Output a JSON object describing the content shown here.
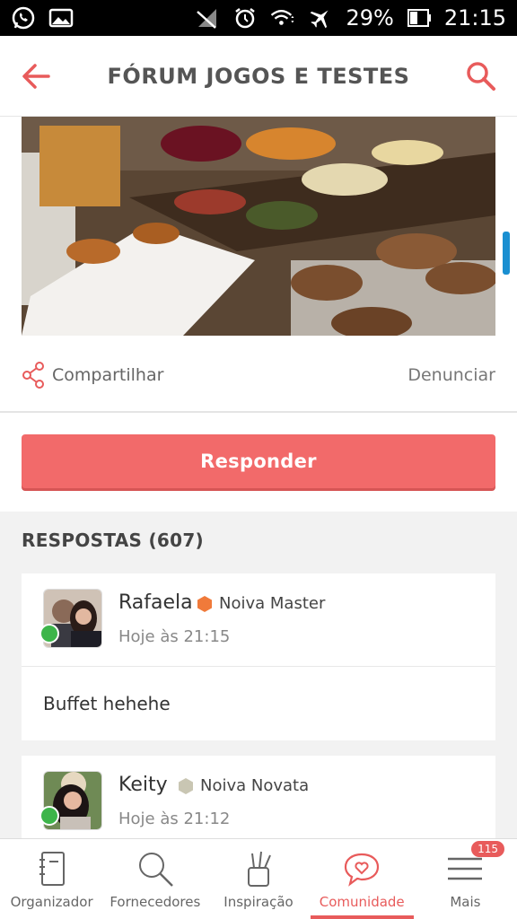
{
  "status_bar": {
    "battery": "29%",
    "time": "21:15"
  },
  "app_bar": {
    "title": "FÓRUM JOGOS E TESTES"
  },
  "post": {
    "image_icon": "buffet-photo",
    "share_label": "Compartilhar",
    "report_label": "Denunciar",
    "reply_label": "Responder"
  },
  "responses": {
    "header": "RESPOSTAS (607)",
    "items": [
      {
        "name": "Rafaela",
        "badge": "Noiva Master",
        "badge_color": "#f07a3a",
        "time": "Hoje às 21:15",
        "text": "Buffet hehehe"
      },
      {
        "name": "Keity",
        "badge": "Noiva Novata",
        "badge_color": "#c9c6b3",
        "time": "Hoje às 21:12",
        "text": ""
      }
    ]
  },
  "bottom_nav": {
    "items": [
      {
        "label": "Organizador",
        "icon": "notebook-icon"
      },
      {
        "label": "Fornecedores",
        "icon": "search-icon"
      },
      {
        "label": "Inspiração",
        "icon": "paintbrush-icon"
      },
      {
        "label": "Comunidade",
        "icon": "heart-chat-icon",
        "active": true
      },
      {
        "label": "Mais",
        "icon": "menu-icon",
        "badge": "115"
      }
    ]
  },
  "colors": {
    "accent": "#f26a6a",
    "online": "#3db54a"
  }
}
